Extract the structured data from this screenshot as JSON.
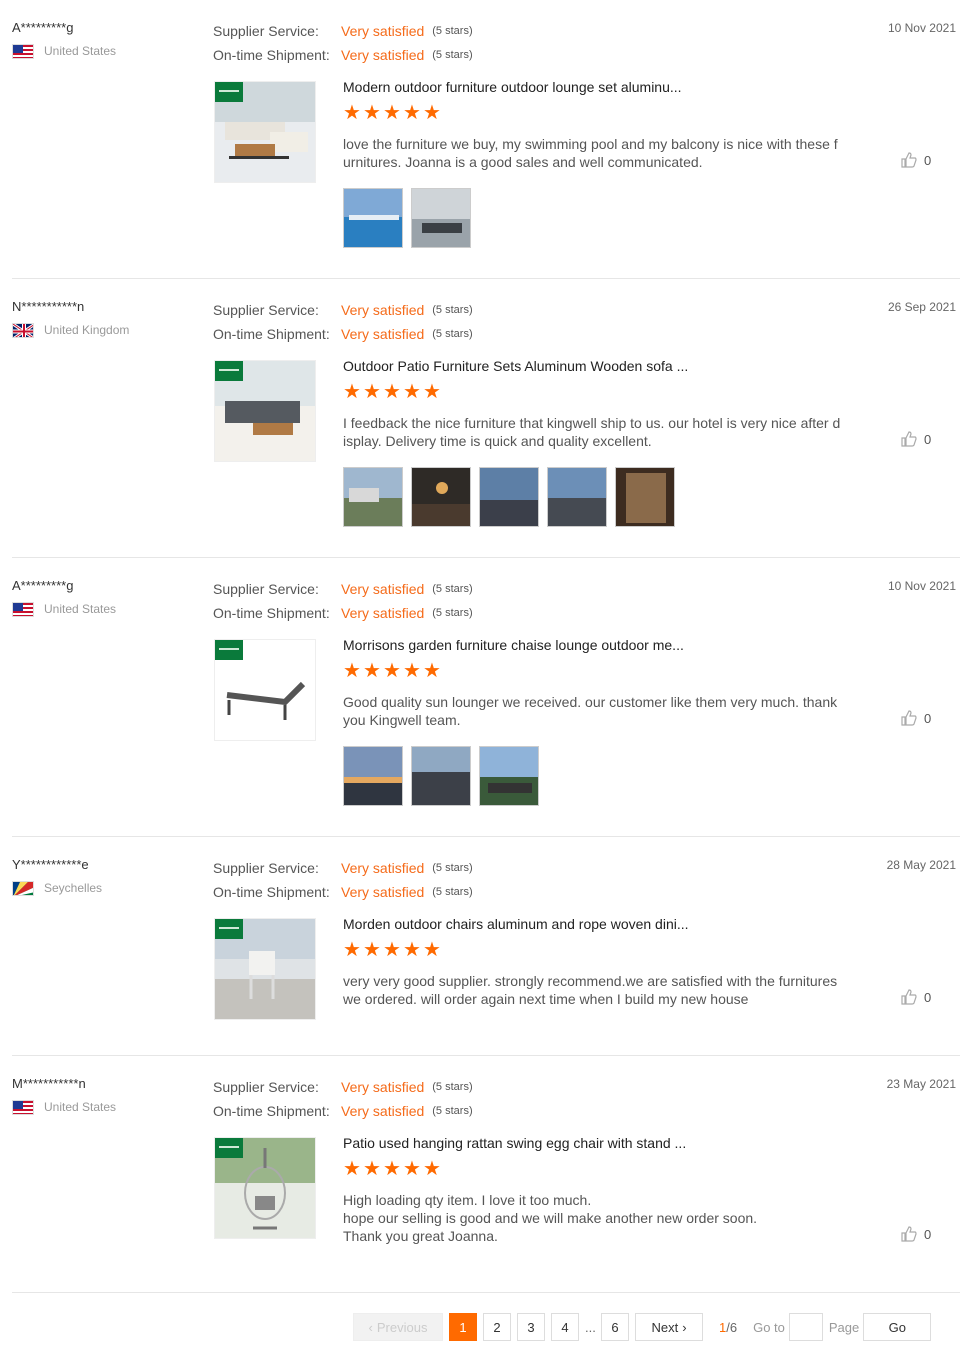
{
  "reviews": [
    {
      "buyer": "A*********g",
      "country": "United States",
      "flag": "us",
      "supplier_label": "Supplier Service:",
      "supplier_value": "Very satisfied",
      "supplier_stars": "(5 stars)",
      "shipment_label": "On-time Shipment:",
      "shipment_value": "Very satisfied",
      "shipment_stars": "(5 stars)",
      "date": "10 Nov 2021",
      "product_title": "Modern outdoor furniture outdoor lounge set aluminu...",
      "rating": 5,
      "comment": "love the furniture we buy, my swimming pool and my balcony is nice with these furnitures. Joanna is a good sales and well communicated.",
      "likes": "0",
      "photos": 2
    },
    {
      "buyer": "N***********n",
      "country": "United Kingdom",
      "flag": "uk",
      "supplier_label": "Supplier Service:",
      "supplier_value": "Very satisfied",
      "supplier_stars": "(5 stars)",
      "shipment_label": "On-time Shipment:",
      "shipment_value": "Very satisfied",
      "shipment_stars": "(5 stars)",
      "date": "26 Sep 2021",
      "product_title": "Outdoor Patio Furniture Sets Aluminum Wooden sofa ...",
      "rating": 5,
      "comment": "I feedback the nice furniture that kingwell ship to us. our hotel is very nice after display. Delivery time is quick and quality excellent.",
      "likes": "0",
      "photos": 5
    },
    {
      "buyer": "A*********g",
      "country": "United States",
      "flag": "us",
      "supplier_label": "Supplier Service:",
      "supplier_value": "Very satisfied",
      "supplier_stars": "(5 stars)",
      "shipment_label": "On-time Shipment:",
      "shipment_value": "Very satisfied",
      "shipment_stars": "(5 stars)",
      "date": "10 Nov 2021",
      "product_title": "Morrisons garden furniture chaise lounge outdoor me...",
      "rating": 5,
      "comment": "Good quality sun lounger we received. our customer like them very much. thank you Kingwell team.",
      "likes": "0",
      "photos": 3
    },
    {
      "buyer": "Y************e",
      "country": "Seychelles",
      "flag": "sc",
      "supplier_label": "Supplier Service:",
      "supplier_value": "Very satisfied",
      "supplier_stars": "(5 stars)",
      "shipment_label": "On-time Shipment:",
      "shipment_value": "Very satisfied",
      "shipment_stars": "(5 stars)",
      "date": "28 May 2021",
      "product_title": "Morden outdoor chairs aluminum and rope woven dini...",
      "rating": 5,
      "comment": "very very good supplier. strongly recommend.we are satisfied with the furnitures we ordered. will order again next time when I build my new house",
      "likes": "0",
      "photos": 0
    },
    {
      "buyer": "M***********n",
      "country": "United States",
      "flag": "us",
      "supplier_label": "Supplier Service:",
      "supplier_value": "Very satisfied",
      "supplier_stars": "(5 stars)",
      "shipment_label": "On-time Shipment:",
      "shipment_value": "Very satisfied",
      "shipment_stars": "(5 stars)",
      "date": "23 May 2021",
      "product_title": "Patio used hanging rattan swing egg chair with stand ...",
      "rating": 5,
      "comment_lines": [
        "High loading qty item. I love it too much.",
        "hope our selling is good and we will make another new order soon.",
        "Thank you great Joanna."
      ],
      "likes": "0",
      "photos": 0
    }
  ],
  "pagination": {
    "previous": "Previous",
    "pages": [
      "1",
      "2",
      "3",
      "4"
    ],
    "ellipsis": "...",
    "last_page": "6",
    "next": "Next",
    "current": "1",
    "total": "/6",
    "goto_label": "Go to",
    "goto_value": "",
    "page_label": "Page",
    "go": "Go"
  },
  "colors": {
    "accent": "#ff6a00",
    "satisfied": "#f56b1a"
  }
}
